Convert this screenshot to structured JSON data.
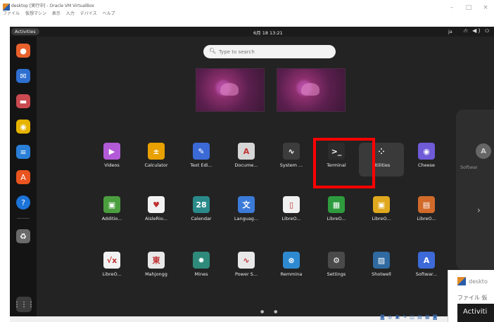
{
  "window": {
    "title": "desktop [実行中] - Oracle VM VirtualBox",
    "menu": [
      "ファイル",
      "仮想マシン",
      "表示",
      "入力",
      "デバイス",
      "ヘルプ"
    ],
    "minimize": "–",
    "maximize": "□",
    "close": "×"
  },
  "topbar": {
    "activities": "Activities",
    "clock": "6月 18 13:21",
    "input_language": "ja",
    "status_icons": "⛙ ◀) ⏻"
  },
  "search": {
    "placeholder": "Type to search"
  },
  "dock": [
    {
      "name": "firefox-icon",
      "glyph": "●",
      "color": "#e8612c"
    },
    {
      "name": "thunderbird-icon",
      "glyph": "✉",
      "color": "#2e6fd0"
    },
    {
      "name": "files-icon",
      "glyph": "▬",
      "color": "#c94a50"
    },
    {
      "name": "rhythmbox-icon",
      "glyph": "◉",
      "color": "#e6b400"
    },
    {
      "name": "writer-icon",
      "glyph": "≡",
      "color": "#2a7fd8"
    },
    {
      "name": "app-center-icon",
      "glyph": "A",
      "color": "#e95420"
    },
    {
      "name": "help-icon",
      "glyph": "?",
      "color": "#1c73d8"
    },
    {
      "name": "trash-icon",
      "glyph": "♻",
      "color": "#6a6a6a"
    }
  ],
  "show_apps": "⋮⋮⋮",
  "apps": [
    {
      "label": "Videos",
      "glyph": "▶",
      "color": "#b25ad8"
    },
    {
      "label": "Calculator",
      "glyph": "±",
      "color": "#e8a100"
    },
    {
      "label": "Text Edi...",
      "glyph": "✎",
      "color": "#3b6ad6"
    },
    {
      "label": "Docume...",
      "glyph": "A",
      "color": "#d6d6d6"
    },
    {
      "label": "System ...",
      "glyph": "∿",
      "color": "#3c3c3c"
    },
    {
      "label": "Terminal",
      "glyph": ">_",
      "color": "#2c2c2c"
    },
    {
      "label": "Utilities",
      "glyph": "⁘",
      "color": "#3a3a3a"
    },
    {
      "label": "Cheese",
      "glyph": "◉",
      "color": "#6f5bd8"
    },
    {
      "label": "Additio...",
      "glyph": "▣",
      "color": "#4b9e3e"
    },
    {
      "label": "AisleRio...",
      "glyph": "♥",
      "color": "#f2f2f2"
    },
    {
      "label": "Calendar",
      "glyph": "28",
      "color": "#2a8a8a"
    },
    {
      "label": "Languag...",
      "glyph": "文",
      "color": "#3b7ad8"
    },
    {
      "label": "LibreO...",
      "glyph": "▯",
      "color": "#f0f0f0"
    },
    {
      "label": "LibreO...",
      "glyph": "▦",
      "color": "#2e9b3e"
    },
    {
      "label": "LibreO...",
      "glyph": "▣",
      "color": "#e0a81e"
    },
    {
      "label": "LibreO...",
      "glyph": "▤",
      "color": "#d26a2a"
    },
    {
      "label": "LibreO...",
      "glyph": "√x",
      "color": "#f2f2f2"
    },
    {
      "label": "Mahjongg",
      "glyph": "東",
      "color": "#e8e8e8"
    },
    {
      "label": "Mines",
      "glyph": "✹",
      "color": "#2e8a7a"
    },
    {
      "label": "Power S...",
      "glyph": "∿",
      "color": "#e8e8e8"
    },
    {
      "label": "Remmina",
      "glyph": "⊗",
      "color": "#2e8ad0"
    },
    {
      "label": "Settings",
      "glyph": "⚙",
      "color": "#4a4a4a"
    },
    {
      "label": "Shotwell",
      "glyph": "▨",
      "color": "#2f6aa0"
    },
    {
      "label": "Softwar...",
      "glyph": "A",
      "color": "#3d6ad8"
    }
  ],
  "side_panel": {
    "app_label": "Softwar",
    "next_arrow": "›"
  },
  "page_dots": "● ●",
  "vb_status_icons": "◙ ◎ ▣ ✎ ◫ ▤ ▦ ◙",
  "mini_window": {
    "title": "deskto",
    "menu": "ファイル 仮",
    "activities": "Activiti"
  }
}
